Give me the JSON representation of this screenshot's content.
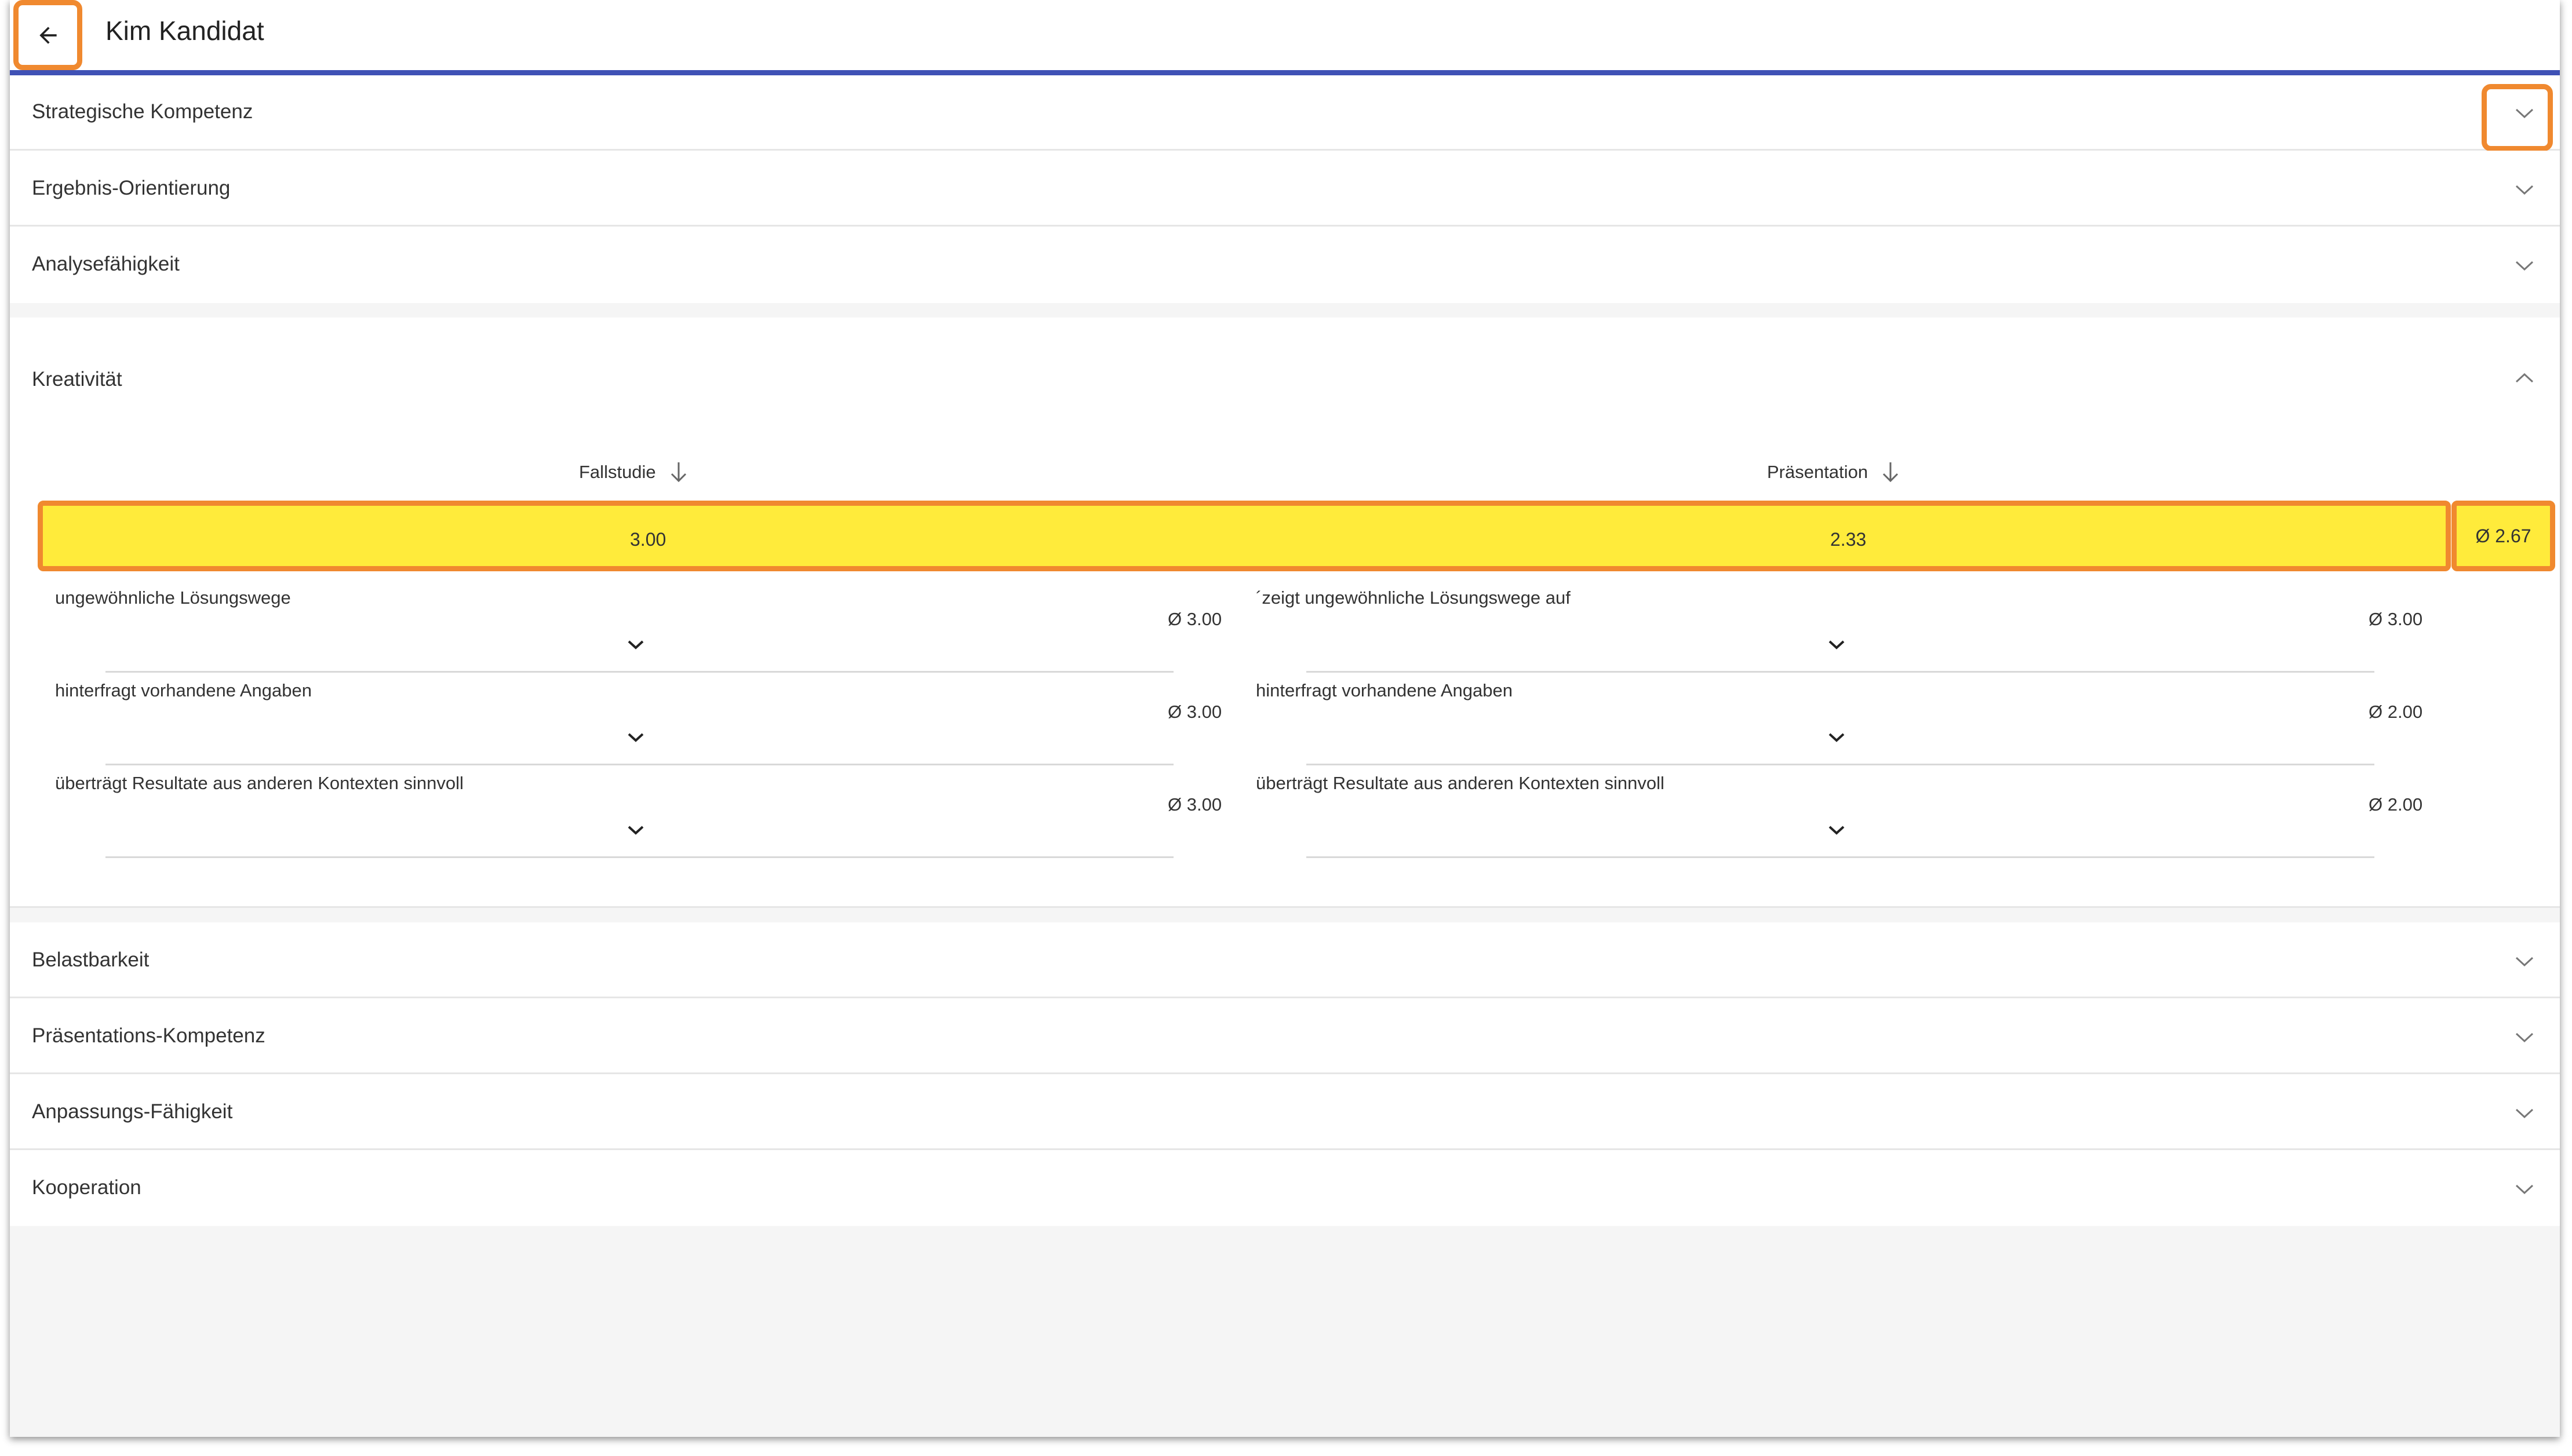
{
  "header": {
    "title": "Kim Kandidat",
    "back_icon": "arrow-left-icon"
  },
  "accent_color": "#3f51b5",
  "highlight_color": "#f0892f",
  "score_color": "#ffeb3b",
  "sections_before": [
    {
      "label": "Strategische Kompetenz"
    },
    {
      "label": "Ergebnis-Orientierung"
    },
    {
      "label": "Analysefähigkeit"
    }
  ],
  "expanded": {
    "label": "Kreativität",
    "columns": [
      {
        "header": "Fallstudie",
        "score": "3.00",
        "criteria": [
          {
            "label": "ungewöhnliche Lösungswege",
            "avg": "Ø 3.00"
          },
          {
            "label": "hinterfragt vorhandene Angaben",
            "avg": "Ø 3.00"
          },
          {
            "label": "überträgt Resultate aus anderen Kontexten sinnvoll",
            "avg": "Ø 3.00"
          }
        ]
      },
      {
        "header": "Präsentation",
        "score": "2.33",
        "criteria": [
          {
            "label": "´zeigt ungewöhnliche Lösungswege auf",
            "avg": "Ø 3.00"
          },
          {
            "label": "hinterfragt vorhandene Angaben",
            "avg": "Ø 2.00"
          },
          {
            "label": "überträgt Resultate aus anderen Kontexten sinnvoll",
            "avg": "Ø 2.00"
          }
        ]
      }
    ],
    "overall_avg": "Ø  2.67"
  },
  "sections_after": [
    {
      "label": "Belastbarkeit"
    },
    {
      "label": "Präsentations-Kompetenz"
    },
    {
      "label": "Anpassungs-Fähigkeit"
    },
    {
      "label": "Kooperation"
    }
  ]
}
